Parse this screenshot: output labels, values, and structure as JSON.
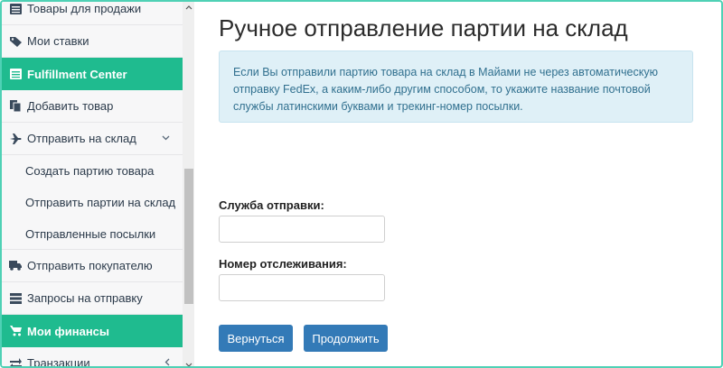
{
  "sidebar": {
    "items": [
      {
        "label": "Товары для продажи",
        "icon": "list-icon",
        "type": "item"
      },
      {
        "label": "Мои ставки",
        "icon": "tag-icon",
        "type": "item"
      },
      {
        "label": "Fulfillment Center",
        "icon": "list-icon",
        "type": "active"
      },
      {
        "label": "Добавить товар",
        "icon": "copy-icon",
        "type": "item"
      },
      {
        "label": "Отправить на склад",
        "icon": "plane-icon",
        "type": "item",
        "chevron": "down"
      },
      {
        "label": "Создать партию товара",
        "type": "sub"
      },
      {
        "label": "Отправить партии на склад",
        "type": "sub"
      },
      {
        "label": "Отправленные посылки",
        "type": "sub"
      },
      {
        "label": "Отправить покупателю",
        "icon": "truck-icon",
        "type": "item"
      },
      {
        "label": "Запросы на отправку",
        "icon": "server-icon",
        "type": "item"
      },
      {
        "label": "Мои финансы",
        "icon": "cart-icon",
        "type": "active"
      },
      {
        "label": "Транзакции",
        "icon": "exchange-icon",
        "type": "item",
        "chevron": "left"
      }
    ]
  },
  "main": {
    "title": "Ручное отправление партии на склад",
    "alert_text": "Если Вы отправили партию товара на склад в Майами не через автоматическую отправку FedEx, а каким-либо другим способом, то укажите название почтовой службы латинскими буквами и трекинг-номер посылки.",
    "shipping_label": "Служба отправки:",
    "shipping_value": "",
    "tracking_label": "Номер отслеживания:",
    "tracking_value": "",
    "back_button": "Вернуться",
    "continue_button": "Продолжить"
  },
  "colors": {
    "accent_green": "#1fbb8f",
    "primary_blue": "#337ab7",
    "alert_bg": "#dff0f7",
    "alert_text": "#31708f"
  }
}
